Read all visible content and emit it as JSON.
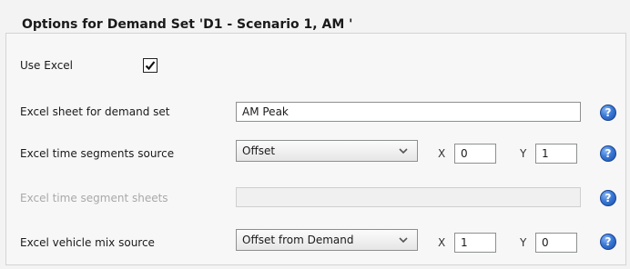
{
  "panel": {
    "title": "Options for Demand Set 'D1 - Scenario 1, AM '"
  },
  "rows": {
    "use_excel": {
      "label": "Use Excel",
      "checked": true
    },
    "sheet": {
      "label": "Excel sheet for demand set",
      "value": "AM Peak"
    },
    "time_segments": {
      "label": "Excel time segments source",
      "selected": "Offset",
      "x_label": "X",
      "x_value": "0",
      "y_label": "Y",
      "y_value": "1"
    },
    "time_segment_sheets": {
      "label": "Excel time segment sheets",
      "value": ""
    },
    "vehicle_mix": {
      "label": "Excel vehicle mix source",
      "selected": "Offset from Demand",
      "x_label": "X",
      "x_value": "1",
      "y_label": "Y",
      "y_value": "0"
    }
  },
  "help_glyph": "?",
  "icons": {
    "help": "help-icon",
    "checkbox": "checkmark-icon",
    "dropdown": "chevron-down-icon"
  },
  "colors": {
    "help_blue": "#3a79d6",
    "disabled_text": "#a9a9a9"
  }
}
